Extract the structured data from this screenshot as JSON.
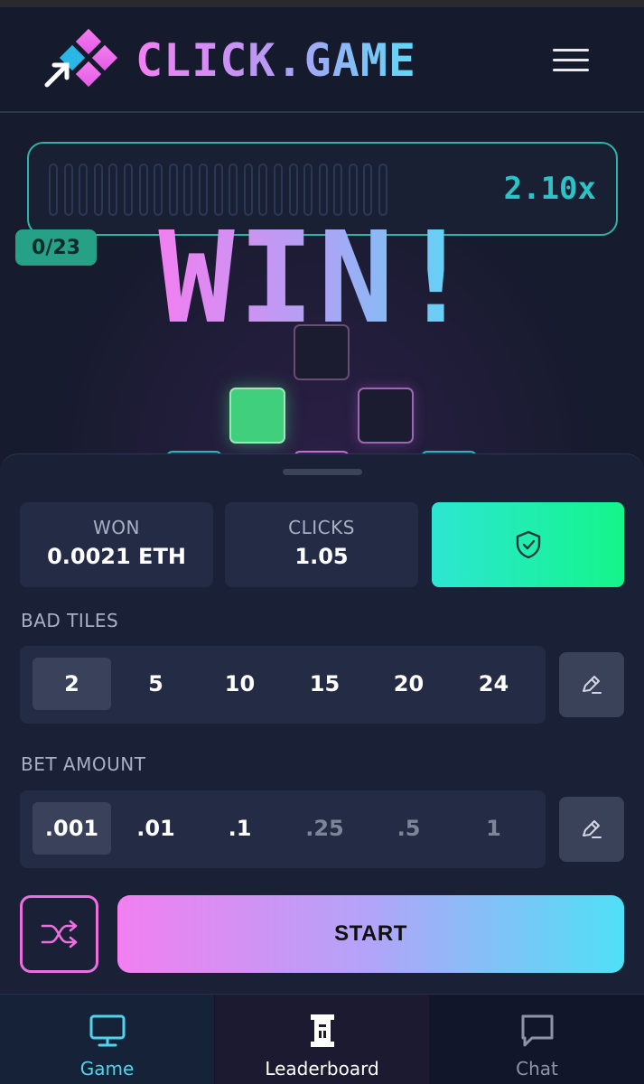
{
  "header": {
    "logo_text": "CLICK.GAME"
  },
  "game": {
    "multiplier": "2.10x",
    "counter": "0/23",
    "result": "WIN!",
    "progress_segments": 23
  },
  "stats": {
    "won_label": "WON",
    "won_value": "0.0021 ETH",
    "clicks_label": "CLICKS",
    "clicks_value": "1.05"
  },
  "bad_tiles": {
    "label": "BAD TILES",
    "options": [
      "2",
      "5",
      "10",
      "15",
      "20",
      "24"
    ],
    "selected": "2"
  },
  "bet_amount": {
    "label": "BET AMOUNT",
    "options": [
      ".001",
      ".01",
      ".1",
      ".25",
      ".5",
      "1"
    ],
    "selected": ".001"
  },
  "actions": {
    "start_label": "START"
  },
  "nav": {
    "items": [
      {
        "label": "Game",
        "icon": "monitor-icon",
        "active": true
      },
      {
        "label": "Leaderboard",
        "icon": "leaderboard-icon",
        "active": false
      },
      {
        "label": "Chat",
        "icon": "chat-icon",
        "active": false
      }
    ]
  },
  "colors": {
    "accent_pink": "#f47ff2",
    "accent_cyan": "#4fe0f6",
    "accent_green": "#14f58a",
    "background": "#171b2e"
  }
}
